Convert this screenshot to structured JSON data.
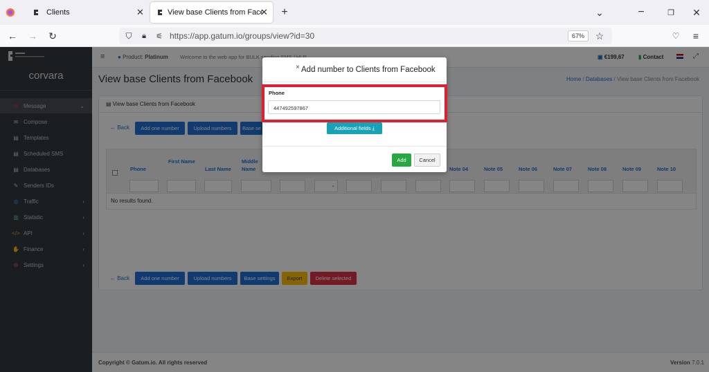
{
  "browser": {
    "tabs": [
      {
        "label": "Clients"
      },
      {
        "label": "View base Clients from Facebook"
      }
    ],
    "url": "https://app.gatum.io/groups/view?id=30",
    "zoom": "67%"
  },
  "sidebar": {
    "brand": "corvara",
    "items": [
      {
        "label": "Message",
        "icon": "envelope-icon"
      },
      {
        "label": "Compose",
        "icon": "envelope-icon"
      },
      {
        "label": "Templates",
        "icon": "file-icon"
      },
      {
        "label": "Scheduled SMS",
        "icon": "file-icon"
      },
      {
        "label": "Databases",
        "icon": "file-icon"
      },
      {
        "label": "Senders IDs",
        "icon": "feather-icon"
      },
      {
        "label": "Traffic",
        "icon": "globe-icon"
      },
      {
        "label": "Statistic",
        "icon": "chart-icon"
      },
      {
        "label": "API",
        "icon": "code-icon"
      },
      {
        "label": "Finance",
        "icon": "hand-coin-icon"
      },
      {
        "label": "Settings",
        "icon": "users-cog-icon"
      }
    ]
  },
  "topbar": {
    "product_label": "Product:",
    "product_value": "Platinum",
    "welcome": "Welcome to the web app for BULK sending SMS / HLR",
    "balance": "€199,67",
    "contact": "Contact"
  },
  "page": {
    "title": "View base Clients from Facebook",
    "breadcrumb": [
      "Home",
      "Databases",
      "View base Clients from Facebook"
    ],
    "card_title": "View base Clients from Facebook",
    "back": "← Back",
    "buttons": {
      "add_one": "Add one number",
      "upload": "Upload numbers",
      "base_settings": "Base settings",
      "export": "Export",
      "delete_selected": "Delete selected",
      "base_short": "Base se"
    },
    "columns": [
      "Phone",
      "First Name",
      "Last Name",
      "Middle Name",
      "Note 04",
      "Note 05",
      "Note 06",
      "Note 07",
      "Note 08",
      "Note 09",
      "Note 10"
    ],
    "empty": "No results found."
  },
  "footer": {
    "copyright": "Copyright © Gatum.io. All rights reserved",
    "version_label": "Version",
    "version": "7.0.1"
  },
  "modal": {
    "title": "Add number to Clients from Facebook",
    "phone_label": "Phone",
    "phone_value": "447492597867",
    "additional": "Additional fields ⤓",
    "add": "Add",
    "cancel": "Cancel"
  }
}
